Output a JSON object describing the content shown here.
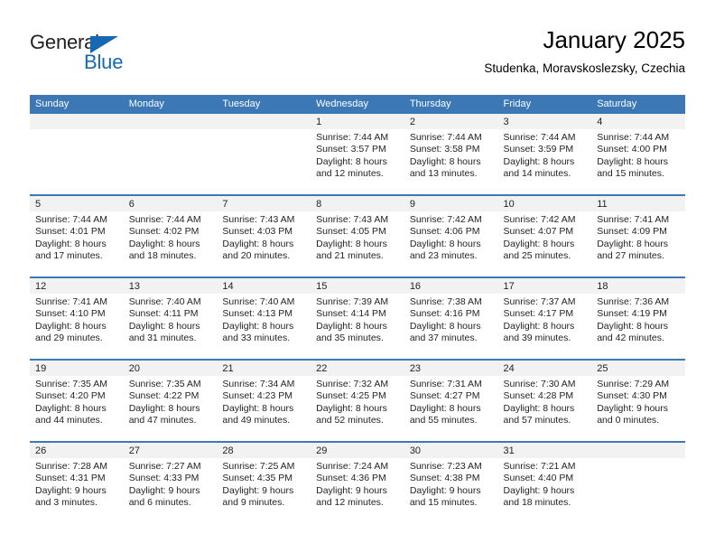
{
  "logo": {
    "word_one": "General",
    "word_two": "Blue",
    "triangle_color": "#1668b3"
  },
  "header": {
    "title": "January 2025",
    "subtitle": "Studenka, Moravskoslezsky, Czechia"
  },
  "theme": {
    "header_bg": "#3b78b5",
    "header_text": "#ffffff",
    "daynum_band_bg": "#f2f2f2",
    "cell_bg": "#ffffff",
    "text": "#231f20"
  },
  "columns": [
    "Sunday",
    "Monday",
    "Tuesday",
    "Wednesday",
    "Thursday",
    "Friday",
    "Saturday"
  ],
  "weeks": [
    [
      {
        "day": "",
        "lines": []
      },
      {
        "day": "",
        "lines": []
      },
      {
        "day": "",
        "lines": []
      },
      {
        "day": "1",
        "lines": [
          "Sunrise: 7:44 AM",
          "Sunset: 3:57 PM",
          "Daylight: 8 hours",
          "and 12 minutes."
        ]
      },
      {
        "day": "2",
        "lines": [
          "Sunrise: 7:44 AM",
          "Sunset: 3:58 PM",
          "Daylight: 8 hours",
          "and 13 minutes."
        ]
      },
      {
        "day": "3",
        "lines": [
          "Sunrise: 7:44 AM",
          "Sunset: 3:59 PM",
          "Daylight: 8 hours",
          "and 14 minutes."
        ]
      },
      {
        "day": "4",
        "lines": [
          "Sunrise: 7:44 AM",
          "Sunset: 4:00 PM",
          "Daylight: 8 hours",
          "and 15 minutes."
        ]
      }
    ],
    [
      {
        "day": "5",
        "lines": [
          "Sunrise: 7:44 AM",
          "Sunset: 4:01 PM",
          "Daylight: 8 hours",
          "and 17 minutes."
        ]
      },
      {
        "day": "6",
        "lines": [
          "Sunrise: 7:44 AM",
          "Sunset: 4:02 PM",
          "Daylight: 8 hours",
          "and 18 minutes."
        ]
      },
      {
        "day": "7",
        "lines": [
          "Sunrise: 7:43 AM",
          "Sunset: 4:03 PM",
          "Daylight: 8 hours",
          "and 20 minutes."
        ]
      },
      {
        "day": "8",
        "lines": [
          "Sunrise: 7:43 AM",
          "Sunset: 4:05 PM",
          "Daylight: 8 hours",
          "and 21 minutes."
        ]
      },
      {
        "day": "9",
        "lines": [
          "Sunrise: 7:42 AM",
          "Sunset: 4:06 PM",
          "Daylight: 8 hours",
          "and 23 minutes."
        ]
      },
      {
        "day": "10",
        "lines": [
          "Sunrise: 7:42 AM",
          "Sunset: 4:07 PM",
          "Daylight: 8 hours",
          "and 25 minutes."
        ]
      },
      {
        "day": "11",
        "lines": [
          "Sunrise: 7:41 AM",
          "Sunset: 4:09 PM",
          "Daylight: 8 hours",
          "and 27 minutes."
        ]
      }
    ],
    [
      {
        "day": "12",
        "lines": [
          "Sunrise: 7:41 AM",
          "Sunset: 4:10 PM",
          "Daylight: 8 hours",
          "and 29 minutes."
        ]
      },
      {
        "day": "13",
        "lines": [
          "Sunrise: 7:40 AM",
          "Sunset: 4:11 PM",
          "Daylight: 8 hours",
          "and 31 minutes."
        ]
      },
      {
        "day": "14",
        "lines": [
          "Sunrise: 7:40 AM",
          "Sunset: 4:13 PM",
          "Daylight: 8 hours",
          "and 33 minutes."
        ]
      },
      {
        "day": "15",
        "lines": [
          "Sunrise: 7:39 AM",
          "Sunset: 4:14 PM",
          "Daylight: 8 hours",
          "and 35 minutes."
        ]
      },
      {
        "day": "16",
        "lines": [
          "Sunrise: 7:38 AM",
          "Sunset: 4:16 PM",
          "Daylight: 8 hours",
          "and 37 minutes."
        ]
      },
      {
        "day": "17",
        "lines": [
          "Sunrise: 7:37 AM",
          "Sunset: 4:17 PM",
          "Daylight: 8 hours",
          "and 39 minutes."
        ]
      },
      {
        "day": "18",
        "lines": [
          "Sunrise: 7:36 AM",
          "Sunset: 4:19 PM",
          "Daylight: 8 hours",
          "and 42 minutes."
        ]
      }
    ],
    [
      {
        "day": "19",
        "lines": [
          "Sunrise: 7:35 AM",
          "Sunset: 4:20 PM",
          "Daylight: 8 hours",
          "and 44 minutes."
        ]
      },
      {
        "day": "20",
        "lines": [
          "Sunrise: 7:35 AM",
          "Sunset: 4:22 PM",
          "Daylight: 8 hours",
          "and 47 minutes."
        ]
      },
      {
        "day": "21",
        "lines": [
          "Sunrise: 7:34 AM",
          "Sunset: 4:23 PM",
          "Daylight: 8 hours",
          "and 49 minutes."
        ]
      },
      {
        "day": "22",
        "lines": [
          "Sunrise: 7:32 AM",
          "Sunset: 4:25 PM",
          "Daylight: 8 hours",
          "and 52 minutes."
        ]
      },
      {
        "day": "23",
        "lines": [
          "Sunrise: 7:31 AM",
          "Sunset: 4:27 PM",
          "Daylight: 8 hours",
          "and 55 minutes."
        ]
      },
      {
        "day": "24",
        "lines": [
          "Sunrise: 7:30 AM",
          "Sunset: 4:28 PM",
          "Daylight: 8 hours",
          "and 57 minutes."
        ]
      },
      {
        "day": "25",
        "lines": [
          "Sunrise: 7:29 AM",
          "Sunset: 4:30 PM",
          "Daylight: 9 hours",
          "and 0 minutes."
        ]
      }
    ],
    [
      {
        "day": "26",
        "lines": [
          "Sunrise: 7:28 AM",
          "Sunset: 4:31 PM",
          "Daylight: 9 hours",
          "and 3 minutes."
        ]
      },
      {
        "day": "27",
        "lines": [
          "Sunrise: 7:27 AM",
          "Sunset: 4:33 PM",
          "Daylight: 9 hours",
          "and 6 minutes."
        ]
      },
      {
        "day": "28",
        "lines": [
          "Sunrise: 7:25 AM",
          "Sunset: 4:35 PM",
          "Daylight: 9 hours",
          "and 9 minutes."
        ]
      },
      {
        "day": "29",
        "lines": [
          "Sunrise: 7:24 AM",
          "Sunset: 4:36 PM",
          "Daylight: 9 hours",
          "and 12 minutes."
        ]
      },
      {
        "day": "30",
        "lines": [
          "Sunrise: 7:23 AM",
          "Sunset: 4:38 PM",
          "Daylight: 9 hours",
          "and 15 minutes."
        ]
      },
      {
        "day": "31",
        "lines": [
          "Sunrise: 7:21 AM",
          "Sunset: 4:40 PM",
          "Daylight: 9 hours",
          "and 18 minutes."
        ]
      },
      {
        "day": "",
        "lines": []
      }
    ]
  ]
}
